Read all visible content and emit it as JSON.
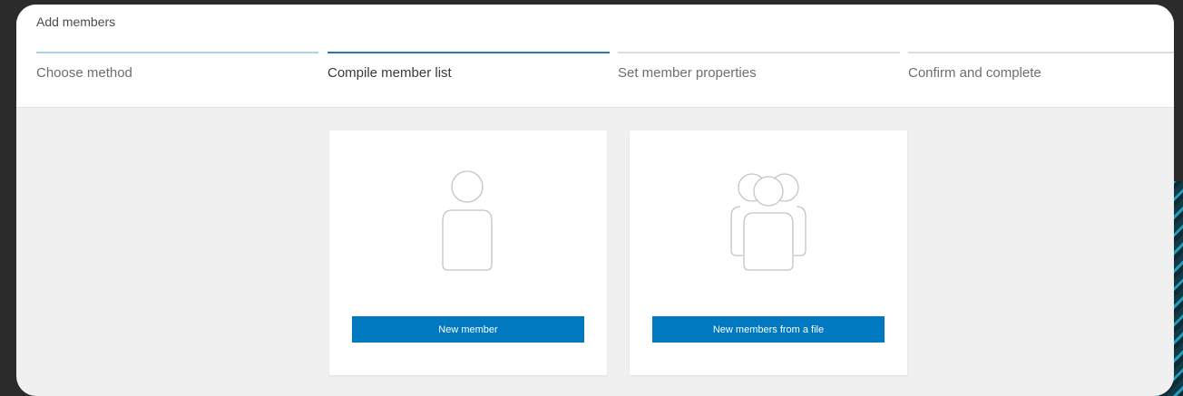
{
  "dialog": {
    "title": "Add members"
  },
  "steps": [
    {
      "label": "Choose method",
      "state": "done"
    },
    {
      "label": "Compile member list",
      "state": "active"
    },
    {
      "label": "Set member properties",
      "state": "pending"
    },
    {
      "label": "Confirm and complete",
      "state": "pending"
    }
  ],
  "cards": [
    {
      "icon": "single-user-icon",
      "button_label": "New member"
    },
    {
      "icon": "multiple-users-icon",
      "button_label": "New members from a file"
    }
  ],
  "colors": {
    "accent": "#0079c1",
    "step_active": "#2b79ab",
    "step_done": "#a9d3e5",
    "step_pending": "#dcdcdc"
  }
}
